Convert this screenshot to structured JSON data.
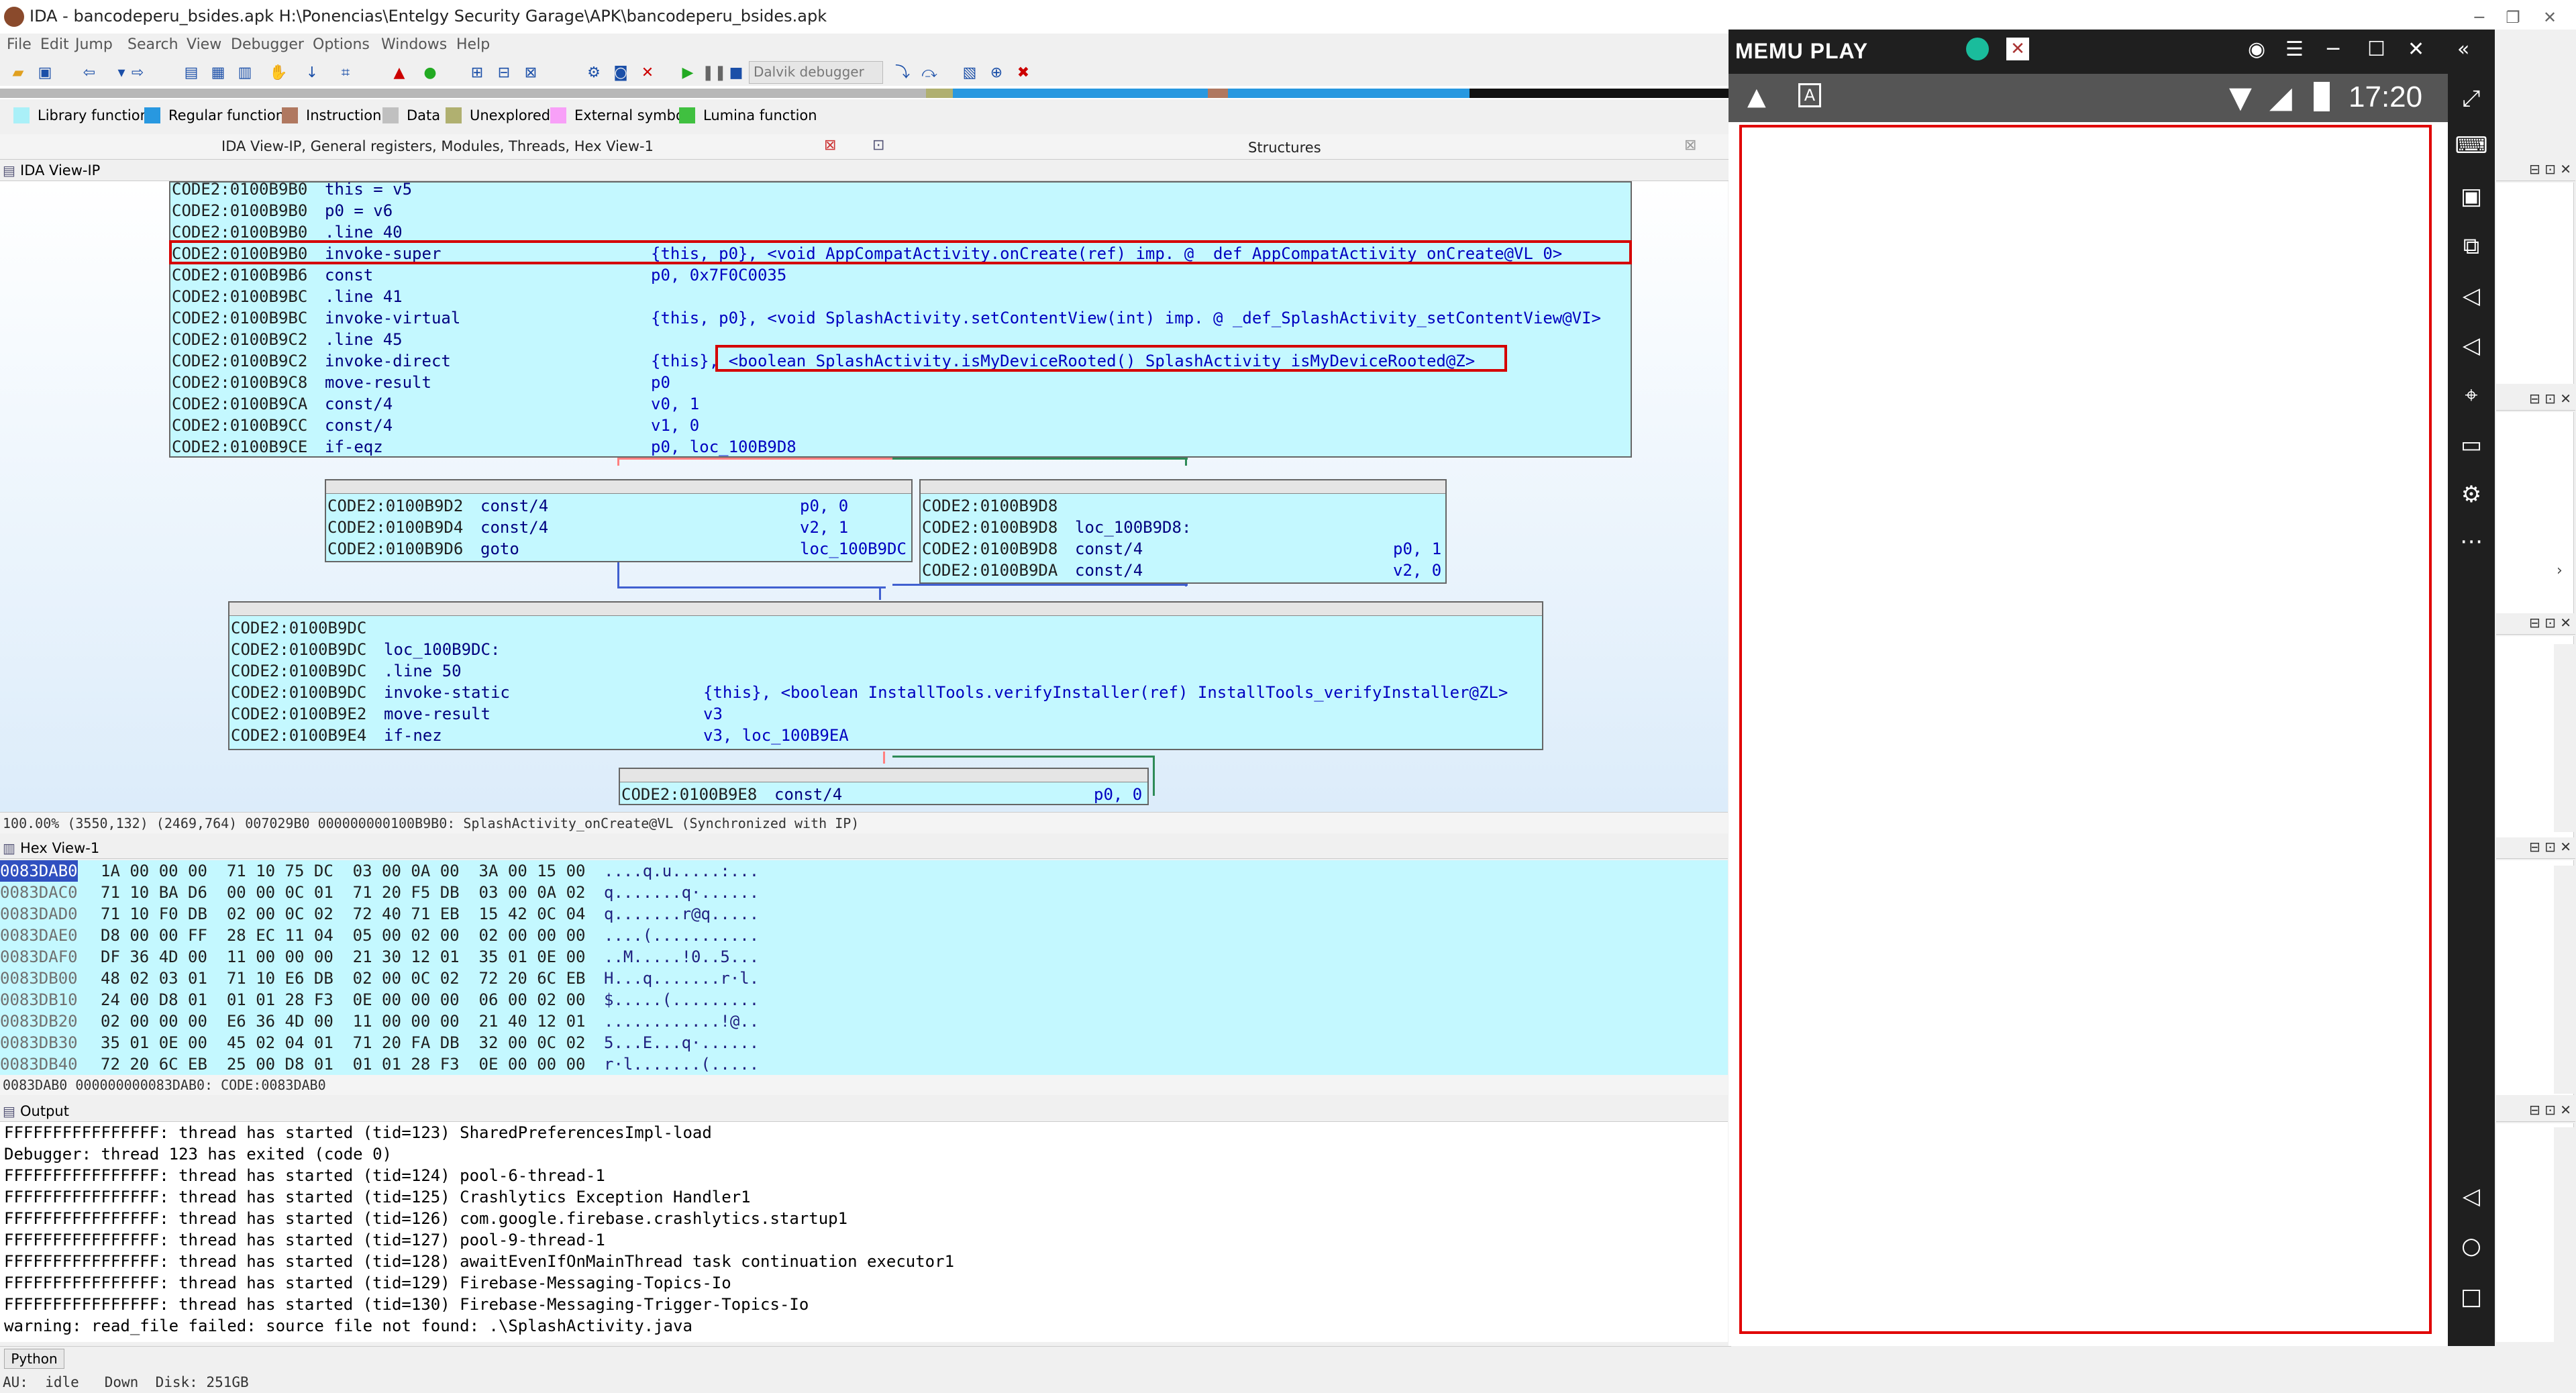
{
  "window": {
    "title": "IDA - bancodeperu_bsides.apk H:\\Ponencias\\Entelgy Security Garage\\APK\\bancodeperu_bsides.apk",
    "minimize": "─",
    "maximize": "❐",
    "close": "✕"
  },
  "menu": [
    "File",
    "Edit",
    "Jump",
    "Search",
    "View",
    "Debugger",
    "Options",
    "Windows",
    "Help"
  ],
  "toolbar": {
    "debugger_select": "Dalvik debugger"
  },
  "legend": [
    {
      "label": "Library function",
      "color": "#aaf0f8"
    },
    {
      "label": "Regular function",
      "color": "#2898e0"
    },
    {
      "label": "Instruction",
      "color": "#b07860"
    },
    {
      "label": "Data",
      "color": "#c0c0c0"
    },
    {
      "label": "Unexplored",
      "color": "#b0b070"
    },
    {
      "label": "External symbol",
      "color": "#f8a0f8"
    },
    {
      "label": "Lumina function",
      "color": "#40c040"
    }
  ],
  "tabs": {
    "main": "IDA View-IP, General registers, Modules, Threads, Hex View-1",
    "structures": "Structures",
    "ida_view": "IDA View-IP"
  },
  "graph": {
    "block1": [
      {
        "addr": "CODE2:0100B9B0",
        "op": "this = v5",
        "args": ""
      },
      {
        "addr": "CODE2:0100B9B0",
        "op": "p0 = v6",
        "args": ""
      },
      {
        "addr": "CODE2:0100B9B0",
        "op": ".line 40",
        "args": ""
      },
      {
        "addr": "CODE2:0100B9B0",
        "op": "invoke-super",
        "args": "{this, p0}, <void AppCompatActivity.onCreate(ref) imp. @ _def_AppCompatActivity_onCreate@VL_0>"
      },
      {
        "addr": "CODE2:0100B9B6",
        "op": "const",
        "args": "p0, 0x7F0C0035"
      },
      {
        "addr": "CODE2:0100B9BC",
        "op": ".line 41",
        "args": ""
      },
      {
        "addr": "CODE2:0100B9BC",
        "op": "invoke-virtual",
        "args": "{this, p0}, <void SplashActivity.setContentView(int) imp. @ _def_SplashActivity_setContentView@VI>"
      },
      {
        "addr": "CODE2:0100B9C2",
        "op": ".line 45",
        "args": ""
      },
      {
        "addr": "CODE2:0100B9C2",
        "op": "invoke-direct",
        "args": "{this}, <boolean SplashActivity.isMyDeviceRooted() SplashActivity_isMyDeviceRooted@Z>"
      },
      {
        "addr": "CODE2:0100B9C8",
        "op": "move-result",
        "args": "p0"
      },
      {
        "addr": "CODE2:0100B9CA",
        "op": "const/4",
        "args": "v0, 1"
      },
      {
        "addr": "CODE2:0100B9CC",
        "op": "const/4",
        "args": "v1, 0"
      },
      {
        "addr": "CODE2:0100B9CE",
        "op": "if-eqz",
        "args": "p0, loc_100B9D8"
      }
    ],
    "block2": [
      {
        "addr": "CODE2:0100B9D2",
        "op": "const/4",
        "args": "p0, 0"
      },
      {
        "addr": "CODE2:0100B9D4",
        "op": "const/4",
        "args": "v2, 1"
      },
      {
        "addr": "CODE2:0100B9D6",
        "op": "goto",
        "args": "loc_100B9DC"
      }
    ],
    "block3": [
      {
        "addr": "CODE2:0100B9D8",
        "op": "",
        "args": ""
      },
      {
        "addr": "CODE2:0100B9D8",
        "op": "loc_100B9D8:",
        "args": ""
      },
      {
        "addr": "CODE2:0100B9D8",
        "op": "const/4",
        "args": "p0, 1"
      },
      {
        "addr": "CODE2:0100B9DA",
        "op": "const/4",
        "args": "v2, 0"
      }
    ],
    "block4": [
      {
        "addr": "CODE2:0100B9DC",
        "op": "",
        "args": ""
      },
      {
        "addr": "CODE2:0100B9DC",
        "op": "loc_100B9DC:",
        "args": ""
      },
      {
        "addr": "CODE2:0100B9DC",
        "op": ".line 50",
        "args": ""
      },
      {
        "addr": "CODE2:0100B9DC",
        "op": "invoke-static",
        "args": "{this}, <boolean InstallTools.verifyInstaller(ref) InstallTools_verifyInstaller@ZL>"
      },
      {
        "addr": "CODE2:0100B9E2",
        "op": "move-result",
        "args": "v3"
      },
      {
        "addr": "CODE2:0100B9E4",
        "op": "if-nez",
        "args": "v3, loc_100B9EA"
      }
    ],
    "block5": [
      {
        "addr": "CODE2:0100B9E8",
        "op": "const/4",
        "args": "p0, 0"
      }
    ],
    "status": "100.00% (3550,132) (2469,764) 007029B0 000000000100B9B0: SplashActivity_onCreate@VL (Synchronized with IP)"
  },
  "hex": {
    "title": "Hex View-1",
    "rows": [
      {
        "addr": "0083DAB0",
        "bytes": "1A 00 00 00  71 10 75 DC  03 00 0A 00  3A 00 15 00",
        "ascii": "....q.u.....:..."
      },
      {
        "addr": "0083DAC0",
        "bytes": "71 10 BA D6  00 00 0C 01  71 20 F5 DB  03 00 0A 02",
        "ascii": "q.......q·......"
      },
      {
        "addr": "0083DAD0",
        "bytes": "71 10 F0 DB  02 00 0C 02  72 40 71 EB  15 42 0C 04",
        "ascii": "q.......r@q....."
      },
      {
        "addr": "0083DAE0",
        "bytes": "D8 00 00 FF  28 EC 11 04  05 00 02 00  02 00 00 00",
        "ascii": "....(..........."
      },
      {
        "addr": "0083DAF0",
        "bytes": "DF 36 4D 00  11 00 00 00  21 30 12 01  35 01 0E 00",
        "ascii": "..M.....!0..5..."
      },
      {
        "addr": "0083DB00",
        "bytes": "48 02 03 01  71 10 E6 DB  02 00 0C 02  72 20 6C EB",
        "ascii": "H...q.......r·l."
      },
      {
        "addr": "0083DB10",
        "bytes": "24 00 D8 01  01 01 28 F3  0E 00 00 00  06 00 02 00",
        "ascii": "$.....(........."
      },
      {
        "addr": "0083DB20",
        "bytes": "02 00 00 00  E6 36 4D 00  11 00 00 00  21 40 12 01",
        "ascii": "............!@.."
      },
      {
        "addr": "0083DB30",
        "bytes": "35 01 0E 00  45 02 04 01  71 20 FA DB  32 00 0C 02",
        "ascii": "5...E...q·......"
      },
      {
        "addr": "0083DB40",
        "bytes": "72 20 6C EB  25 00 D8 01  01 01 28 F3  0E 00 00 00",
        "ascii": "r·l.......(....."
      }
    ],
    "status": "0083DAB0 000000000083DAB0: CODE:0083DAB0"
  },
  "output": {
    "title": "Output",
    "lines": [
      "FFFFFFFFFFFFFFFF: thread has started (tid=123) SharedPreferencesImpl-load",
      "Debugger: thread 123 has exited (code 0)",
      "FFFFFFFFFFFFFFFF: thread has started (tid=124) pool-6-thread-1",
      "FFFFFFFFFFFFFFFF: thread has started (tid=125) Crashlytics Exception Handler1",
      "FFFFFFFFFFFFFFFF: thread has started (tid=126) com.google.firebase.crashlytics.startup1",
      "FFFFFFFFFFFFFFFF: thread has started (tid=127) pool-9-thread-1",
      "FFFFFFFFFFFFFFFF: thread has started (tid=128) awaitEvenIfOnMainThread task continuation executor1",
      "FFFFFFFFFFFFFFFF: thread has started (tid=129) Firebase-Messaging-Topics-Io",
      "FFFFFFFFFFFFFFFF: thread has started (tid=130) Firebase-Messaging-Trigger-Topics-Io",
      "warning: read_file failed: source file not found: .\\SplashActivity.java"
    ]
  },
  "python_button": "Python",
  "statusbar": "AU:  idle   Down  Disk: 251GB",
  "memu": {
    "logo": "MEMU PLAY",
    "time": "17:20"
  }
}
